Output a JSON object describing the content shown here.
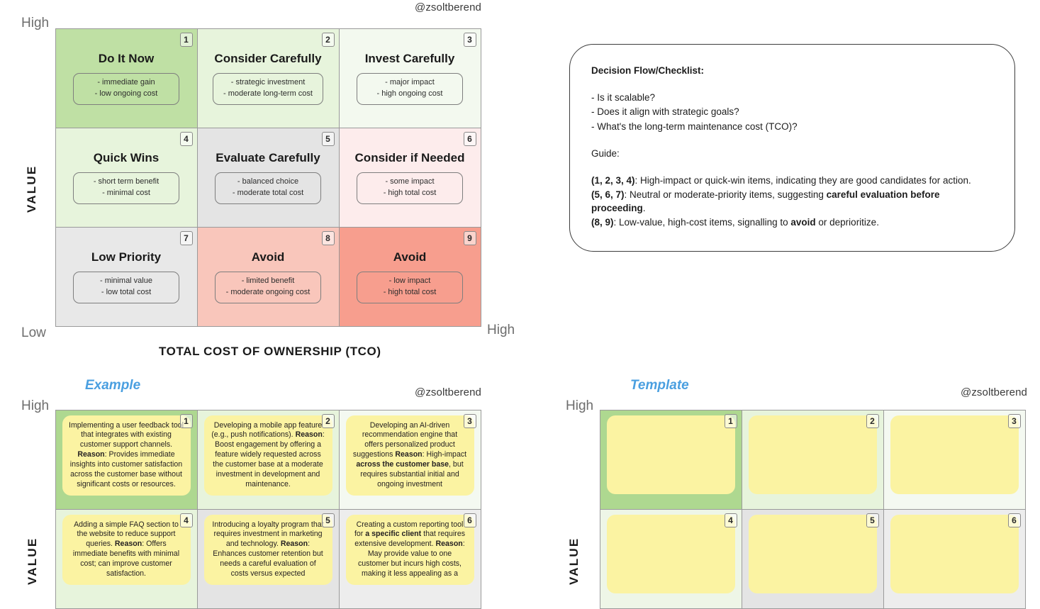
{
  "watermark": "@zsoltberend",
  "axes": {
    "value_label": "VALUE",
    "tco_label": "TOTAL COST OF OWNERSHIP (TCO)",
    "high": "High",
    "low": "Low"
  },
  "sections": {
    "example_label": "Example",
    "template_label": "Template"
  },
  "colors": {
    "green_strong": "#bfe0a4",
    "green_light": "#e7f4dc",
    "green_faint": "#f3f9ef",
    "gray_mid": "#e4e4e4",
    "gray_light": "#ebebeb",
    "pink_faint": "#fdecec",
    "pink_mid": "#f9c6bb",
    "salmon": "#f79e8e",
    "sticky_yellow": "#fbf3a2",
    "accent_blue": "#4a9fe0"
  },
  "matrix": {
    "cells": [
      {
        "num": "1",
        "title": "Do It Now",
        "note": [
          "- immediate gain",
          "- low ongoing cost"
        ],
        "bg": "#bfe0a4"
      },
      {
        "num": "2",
        "title": "Consider Carefully",
        "note": [
          "- strategic investment",
          "- moderate long-term cost"
        ],
        "bg": "#e7f4dc"
      },
      {
        "num": "3",
        "title": "Invest Carefully",
        "note": [
          "- major impact",
          "- high ongoing cost"
        ],
        "bg": "#f3f9ef"
      },
      {
        "num": "4",
        "title": "Quick Wins",
        "note": [
          "- short term benefit",
          "- minimal cost"
        ],
        "bg": "#e7f4dc"
      },
      {
        "num": "5",
        "title": "Evaluate Carefully",
        "note": [
          "- balanced choice",
          "- moderate total cost"
        ],
        "bg": "#e4e4e4"
      },
      {
        "num": "6",
        "title": "Consider if Needed",
        "note": [
          "- some impact",
          "- high total cost"
        ],
        "bg": "#fdecec"
      },
      {
        "num": "7",
        "title": "Low Priority",
        "note": [
          "- minimal value",
          "- low total cost"
        ],
        "bg": "#e8e8e8"
      },
      {
        "num": "8",
        "title": "Avoid",
        "note": [
          "- limited benefit",
          "- moderate ongoing cost"
        ],
        "bg": "#f9c6bb"
      },
      {
        "num": "9",
        "title": "Avoid",
        "note": [
          "- low impact",
          "- high total cost"
        ],
        "bg": "#f79e8e"
      }
    ]
  },
  "checklist": {
    "heading": "Decision Flow/Checklist:",
    "questions": [
      "- Is it scalable?",
      "- Does it align with strategic goals?",
      "- What's the long-term maintenance cost (TCO)?"
    ],
    "guide_label": "Guide",
    "guide_colon": ":",
    "guide_rows": [
      {
        "key": "(1, 2, 3, 4)",
        "parts": [
          {
            "text": ": High-impact or quick-win items, indicating they are good candidates for action.",
            "bold": false
          }
        ]
      },
      {
        "key": "(5, 6, 7)",
        "parts": [
          {
            "text": ": Neutral or moderate-priority items, suggesting ",
            "bold": false
          },
          {
            "text": "careful evaluation before proceeding",
            "bold": true
          },
          {
            "text": ".",
            "bold": false
          }
        ]
      },
      {
        "key": "(8, 9)",
        "parts": [
          {
            "text": ": Low-value, high-cost items, signalling to ",
            "bold": false
          },
          {
            "text": "avoid",
            "bold": true
          },
          {
            "text": " or deprioritize.",
            "bold": false
          }
        ]
      }
    ]
  },
  "example": {
    "cells": [
      {
        "num": "1",
        "bg": "#aed890",
        "parts": [
          {
            "text": "Implementing a user feedback tool that integrates with existing customer support channels. ",
            "bold": false
          },
          {
            "text": "Reason",
            "bold": true
          },
          {
            "text": ": Provides immediate insights into customer satisfaction across the customer base without significant costs or resources.",
            "bold": false
          }
        ]
      },
      {
        "num": "2",
        "bg": "#e7f4dc",
        "parts": [
          {
            "text": "Developing a mobile app feature (e.g., push notifications). ",
            "bold": false
          },
          {
            "text": "Reason",
            "bold": true
          },
          {
            "text": ": Boost engagement by offering a feature widely requested across the customer base at a moderate investment in development and maintenance.",
            "bold": false
          }
        ]
      },
      {
        "num": "3",
        "bg": "#f4f9f1",
        "parts": [
          {
            "text": "Developing an AI-driven recommendation engine that offers personalized product suggestions ",
            "bold": false
          },
          {
            "text": "Reason",
            "bold": true
          },
          {
            "text": ": High-impact ",
            "bold": false
          },
          {
            "text": "across the customer base",
            "bold": true
          },
          {
            "text": ", but requires substantial initial and ongoing investment",
            "bold": false
          }
        ]
      },
      {
        "num": "4",
        "bg": "#e7f4dc",
        "parts": [
          {
            "text": "Adding a simple FAQ section to the website to reduce support queries. ",
            "bold": false
          },
          {
            "text": "Reason",
            "bold": true
          },
          {
            "text": ": Offers immediate benefits with minimal cost; can improve customer satisfaction.",
            "bold": false
          }
        ]
      },
      {
        "num": "5",
        "bg": "#e4e4e4",
        "parts": [
          {
            "text": "Introducing a loyalty program that requires investment in marketing and technology. ",
            "bold": false
          },
          {
            "text": "Reason",
            "bold": true
          },
          {
            "text": ": Enhances customer retention but needs a careful evaluation of costs versus expected",
            "bold": false
          }
        ]
      },
      {
        "num": "6",
        "bg": "#ededed",
        "parts": [
          {
            "text": "Creating a custom reporting tool for ",
            "bold": false
          },
          {
            "text": "a specific client",
            "bold": true
          },
          {
            "text": " that requires extensive development. ",
            "bold": false
          },
          {
            "text": "Reason",
            "bold": true
          },
          {
            "text": ": May provide value to one customer but incurs high costs, making it less appealing as a",
            "bold": false
          }
        ]
      }
    ]
  },
  "template": {
    "cells": [
      {
        "num": "1",
        "bg": "#aed890"
      },
      {
        "num": "2",
        "bg": "#e7f4dc"
      },
      {
        "num": "3",
        "bg": "#f4f9f1"
      },
      {
        "num": "4",
        "bg": "#eef6e7"
      },
      {
        "num": "5",
        "bg": "#e4e4e4"
      },
      {
        "num": "6",
        "bg": "#ededed"
      }
    ]
  }
}
